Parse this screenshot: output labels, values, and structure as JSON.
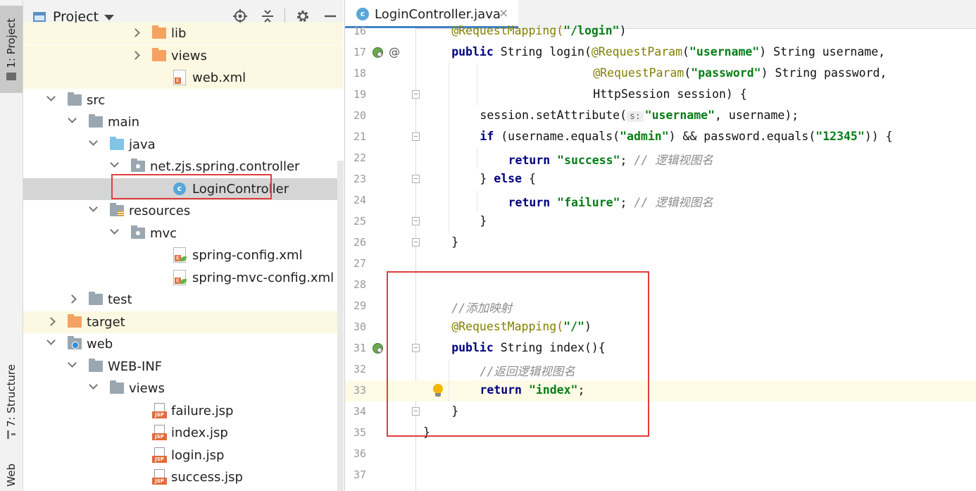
{
  "side_tabs": {
    "project": "1: Project",
    "structure": "7: Structure",
    "web": "Web"
  },
  "project_panel": {
    "title": "Project",
    "header_icons": [
      "target-icon",
      "collapse-all-icon",
      "gear-icon",
      "minimize-icon"
    ]
  },
  "tree": [
    {
      "label": "lib",
      "icon": "folder-orange-icon",
      "depth": 5,
      "arrow": "right",
      "highlight": true
    },
    {
      "label": "views",
      "icon": "folder-orange-icon",
      "depth": 5,
      "arrow": "right",
      "highlight": true
    },
    {
      "label": "web.xml",
      "icon": "xml-file-icon",
      "depth": 6,
      "arrow": "",
      "highlight": true
    },
    {
      "label": "src",
      "icon": "folder-icon",
      "depth": 1,
      "arrow": "down"
    },
    {
      "label": "main",
      "icon": "folder-icon",
      "depth": 2,
      "arrow": "down"
    },
    {
      "label": "java",
      "icon": "source-folder-icon",
      "depth": 3,
      "arrow": "down"
    },
    {
      "label": "net.zjs.spring.controller",
      "icon": "package-icon",
      "depth": 4,
      "arrow": "down"
    },
    {
      "label": "LoginController",
      "icon": "class-icon",
      "depth": 6,
      "arrow": "",
      "selected": true
    },
    {
      "label": "resources",
      "icon": "resources-folder-icon",
      "depth": 3,
      "arrow": "down"
    },
    {
      "label": "mvc",
      "icon": "package-icon",
      "depth": 4,
      "arrow": "down"
    },
    {
      "label": "spring-config.xml",
      "icon": "spring-xml-icon",
      "depth": 6,
      "arrow": ""
    },
    {
      "label": "spring-mvc-config.xml",
      "icon": "spring-xml-icon",
      "depth": 6,
      "arrow": ""
    },
    {
      "label": "test",
      "icon": "folder-icon",
      "depth": 2,
      "arrow": "right"
    },
    {
      "label": "target",
      "icon": "folder-orange-icon",
      "depth": 1,
      "arrow": "right",
      "highlight": true
    },
    {
      "label": "web",
      "icon": "web-folder-icon",
      "depth": 1,
      "arrow": "down"
    },
    {
      "label": "WEB-INF",
      "icon": "folder-icon",
      "depth": 2,
      "arrow": "down"
    },
    {
      "label": "views",
      "icon": "folder-icon",
      "depth": 3,
      "arrow": "down"
    },
    {
      "label": "failure.jsp",
      "icon": "jsp-file-icon",
      "depth": 5,
      "arrow": ""
    },
    {
      "label": "index.jsp",
      "icon": "jsp-file-icon",
      "depth": 5,
      "arrow": ""
    },
    {
      "label": "login.jsp",
      "icon": "jsp-file-icon",
      "depth": 5,
      "arrow": ""
    },
    {
      "label": "success.jsp",
      "icon": "jsp-file-icon",
      "depth": 5,
      "arrow": ""
    }
  ],
  "editor": {
    "tab_label": "LoginController.java",
    "tab_icon": "class-icon",
    "tab_icon_letter": "c",
    "close_glyph": "×",
    "lines": [
      {
        "num": "16",
        "indent": 1,
        "tokens": [
          {
            "t": "@RequestMapping(",
            "c": "ann"
          },
          {
            "t": "\"/login\"",
            "c": "str"
          },
          {
            "t": ")",
            "c": ""
          }
        ]
      },
      {
        "num": "17",
        "indent": 1,
        "gutter": [
          "bean-icon",
          "override-at-icon"
        ],
        "tokens": [
          {
            "t": "public ",
            "c": "kw"
          },
          {
            "t": "String login(",
            "c": ""
          },
          {
            "t": "@RequestParam",
            "c": "ann"
          },
          {
            "t": "(",
            "c": ""
          },
          {
            "t": "\"username\"",
            "c": "str"
          },
          {
            "t": ") String username,",
            "c": ""
          }
        ]
      },
      {
        "num": "18",
        "indent": 6,
        "tokens": [
          {
            "t": "@RequestParam",
            "c": "ann"
          },
          {
            "t": "(",
            "c": ""
          },
          {
            "t": "\"password\"",
            "c": "str"
          },
          {
            "t": ") String password,",
            "c": ""
          }
        ]
      },
      {
        "num": "19",
        "indent": 6,
        "fold": true,
        "tokens": [
          {
            "t": "HttpSession session) {",
            "c": ""
          }
        ]
      },
      {
        "num": "20",
        "indent": 2,
        "tokens": [
          {
            "t": "session.setAttribute(",
            "c": ""
          },
          {
            "t": "s:",
            "c": "hint"
          },
          {
            "t": "\"username\"",
            "c": "str"
          },
          {
            "t": ", username);",
            "c": ""
          }
        ]
      },
      {
        "num": "21",
        "indent": 2,
        "fold": true,
        "tokens": [
          {
            "t": "if ",
            "c": "kw"
          },
          {
            "t": "(username.equals(",
            "c": ""
          },
          {
            "t": "\"admin\"",
            "c": "str"
          },
          {
            "t": ") && password.equals(",
            "c": ""
          },
          {
            "t": "\"12345\"",
            "c": "str"
          },
          {
            "t": ")) {",
            "c": ""
          }
        ]
      },
      {
        "num": "22",
        "indent": 3,
        "tokens": [
          {
            "t": "return ",
            "c": "kw"
          },
          {
            "t": "\"success\"",
            "c": "str"
          },
          {
            "t": "; ",
            "c": ""
          },
          {
            "t": "// 逻辑视图名",
            "c": "cmt"
          }
        ]
      },
      {
        "num": "23",
        "indent": 2,
        "fold": true,
        "tokens": [
          {
            "t": "} ",
            "c": ""
          },
          {
            "t": "else",
            "c": "kw"
          },
          {
            "t": " {",
            "c": ""
          }
        ]
      },
      {
        "num": "24",
        "indent": 3,
        "tokens": [
          {
            "t": "return ",
            "c": "kw"
          },
          {
            "t": "\"failure\"",
            "c": "str"
          },
          {
            "t": "; ",
            "c": ""
          },
          {
            "t": "// 逻辑视图名",
            "c": "cmt"
          }
        ]
      },
      {
        "num": "25",
        "indent": 2,
        "fold": true,
        "tokens": [
          {
            "t": "}",
            "c": ""
          }
        ]
      },
      {
        "num": "26",
        "indent": 1,
        "fold": true,
        "tokens": [
          {
            "t": "}",
            "c": ""
          }
        ]
      },
      {
        "num": "27",
        "indent": 0,
        "tokens": []
      },
      {
        "num": "28",
        "indent": 0,
        "tokens": []
      },
      {
        "num": "29",
        "indent": 1,
        "tokens": [
          {
            "t": "//添加映射",
            "c": "cmt"
          }
        ]
      },
      {
        "num": "30",
        "indent": 1,
        "tokens": [
          {
            "t": "@RequestMapping(",
            "c": "ann"
          },
          {
            "t": "\"/\"",
            "c": "str"
          },
          {
            "t": ")",
            "c": ""
          }
        ]
      },
      {
        "num": "31",
        "indent": 1,
        "gutter": [
          "bean-icon"
        ],
        "fold": true,
        "tokens": [
          {
            "t": "public ",
            "c": "kw"
          },
          {
            "t": "String index(){",
            "c": ""
          }
        ]
      },
      {
        "num": "32",
        "indent": 2,
        "tokens": [
          {
            "t": "//返回逻辑视图名",
            "c": "cmt"
          }
        ]
      },
      {
        "num": "33",
        "indent": 2,
        "current": true,
        "bulb": true,
        "tokens": [
          {
            "t": "return ",
            "c": "kw"
          },
          {
            "t": "\"index\"",
            "c": "str"
          },
          {
            "t": ";",
            "c": ""
          }
        ]
      },
      {
        "num": "34",
        "indent": 1,
        "fold": true,
        "tokens": [
          {
            "t": "}",
            "c": ""
          }
        ]
      },
      {
        "num": "35",
        "indent": 0,
        "tokens": [
          {
            "t": "}",
            "c": ""
          }
        ]
      },
      {
        "num": "36",
        "indent": 0,
        "tokens": []
      },
      {
        "num": "37",
        "indent": 0,
        "tokens": []
      }
    ]
  },
  "colors": {
    "highlight_box": "#e03c3c",
    "keyword": "#000080",
    "string": "#067d17",
    "annotation": "#808000",
    "comment": "#8c8c8c",
    "selected_row": "#d5d5d5",
    "excluded_row": "#fcf8e1",
    "current_line": "#fdfbe6"
  }
}
